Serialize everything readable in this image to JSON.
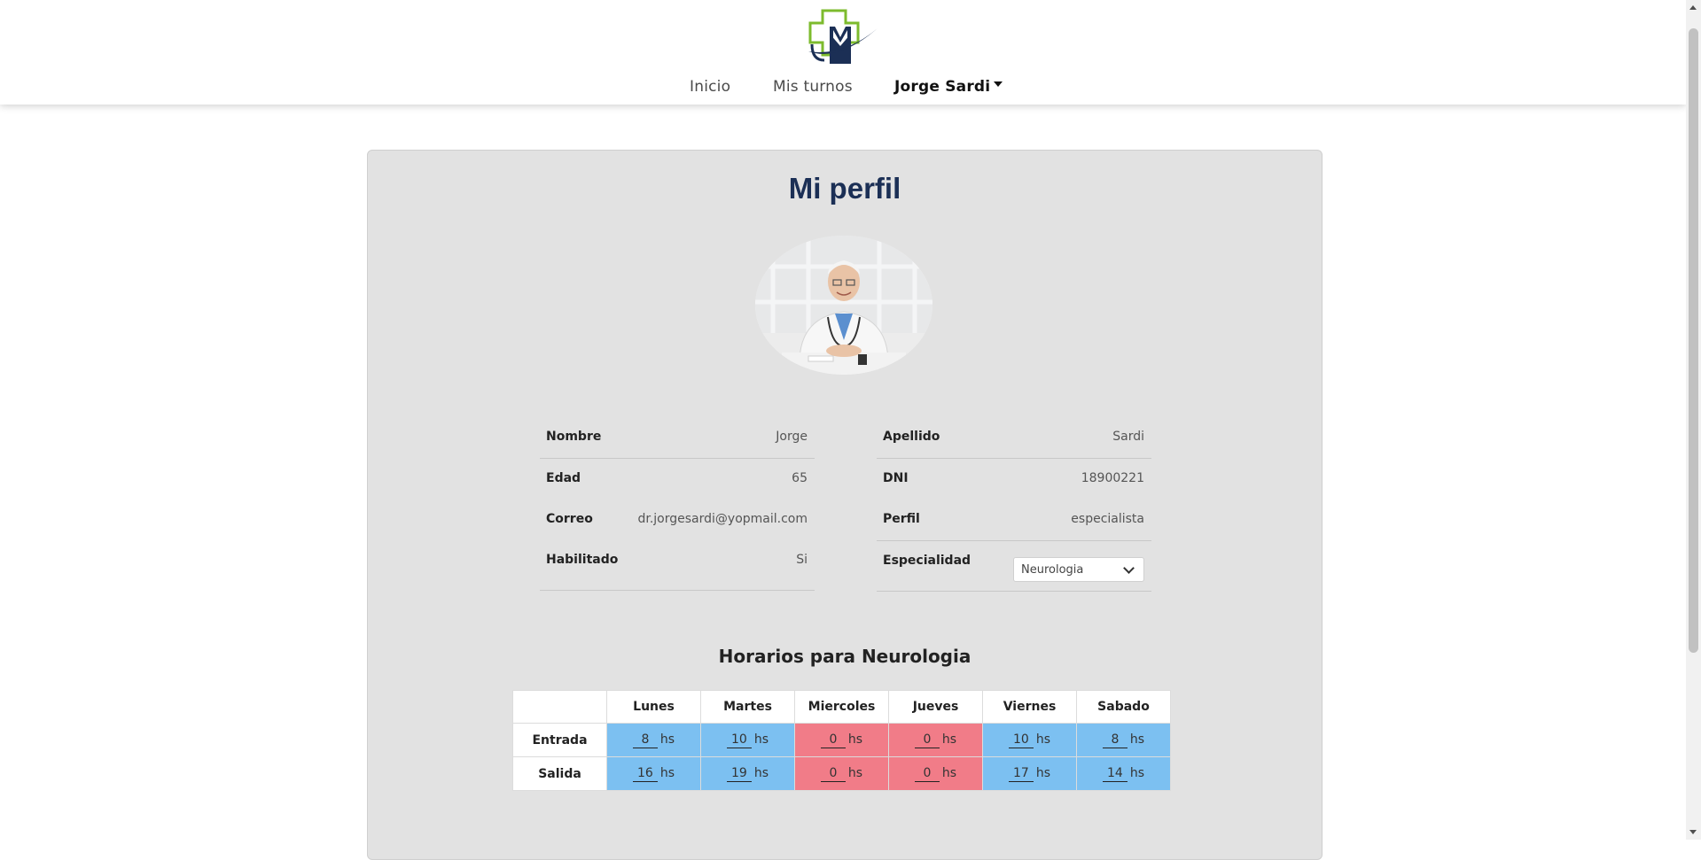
{
  "nav": {
    "links": [
      "Inicio",
      "Mis turnos"
    ],
    "user": "Jorge Sardi"
  },
  "profile": {
    "title": "Mi perfil",
    "fields": {
      "nombre": {
        "label": "Nombre",
        "value": "Jorge"
      },
      "apellido": {
        "label": "Apellido",
        "value": "Sardi"
      },
      "edad": {
        "label": "Edad",
        "value": "65"
      },
      "dni": {
        "label": "DNI",
        "value": "18900221"
      },
      "correo": {
        "label": "Correo",
        "value": "dr.jorgesardi@yopmail.com"
      },
      "perfil": {
        "label": "Perfil",
        "value": "especialista"
      },
      "habilitado": {
        "label": "Habilitado",
        "value": "Si"
      },
      "especialidad": {
        "label": "Especialidad",
        "value": "Neurologia"
      }
    }
  },
  "schedule": {
    "title": "Horarios para Neurologia",
    "days": [
      "Lunes",
      "Martes",
      "Miercoles",
      "Jueves",
      "Viernes",
      "Sabado"
    ],
    "unit": "hs",
    "rows": [
      {
        "label": "Entrada",
        "values": [
          "8",
          "10",
          "0",
          "0",
          "10",
          "8"
        ]
      },
      {
        "label": "Salida",
        "values": [
          "16",
          "19",
          "0",
          "0",
          "17",
          "14"
        ]
      }
    ]
  },
  "colors": {
    "title": "#1b2f55",
    "enabled_cell": "#7cc0f1",
    "disabled_cell": "#f17c88",
    "card_bg": "#e2e2e2"
  }
}
